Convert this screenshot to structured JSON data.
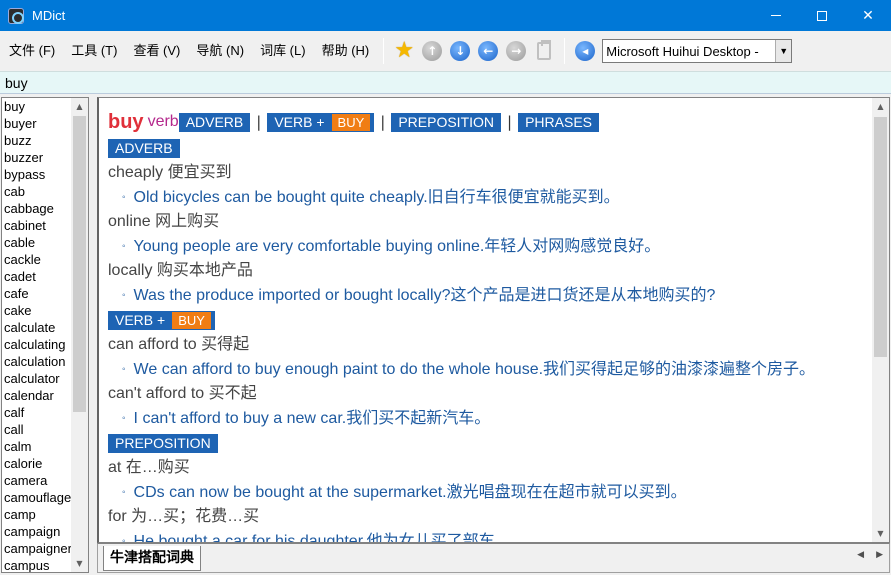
{
  "window": {
    "title": "MDict"
  },
  "menu": [
    "文件 (F)",
    "工具 (T)",
    "查看 (V)",
    "导航 (N)",
    "词库 (L)",
    "帮助 (H)"
  ],
  "toolbar": {
    "font_value": "Microsoft Huihui Desktop -"
  },
  "search": {
    "value": "buy"
  },
  "wordlist": [
    "buy",
    "buyer",
    "buzz",
    "buzzer",
    "bypass",
    "cab",
    "cabbage",
    "cabinet",
    "cable",
    "cackle",
    "cadet",
    "cafe",
    "cake",
    "calculate",
    "calculating",
    "calculation",
    "calculator",
    "calendar",
    "calf",
    "call",
    "calm",
    "calorie",
    "camera",
    "camouflage",
    "camp",
    "campaign",
    "campaigner",
    "campus"
  ],
  "entry": {
    "headword": "buy",
    "pos": "verb",
    "nav": {
      "adverb": "ADVERB",
      "verb": "VERB +",
      "verb_obj": "BUY",
      "preposition": "PREPOSITION",
      "phrases": "PHRASES",
      "sep": "|"
    },
    "sections": [
      {
        "label": "ADVERB",
        "items": [
          {
            "collocation": "cheaply 便宜买到",
            "example": "Old bicycles can be bought quite cheaply.旧自行车很便宜就能买到。"
          },
          {
            "collocation": "online 网上购买",
            "example": "Young people are very comfortable buying online.年轻人对网购感觉良好。"
          },
          {
            "collocation": "locally 购买本地产品",
            "example": "Was the produce imported or bought locally?这个产品是进口货还是从本地购买的?"
          }
        ]
      },
      {
        "label": "VERB +",
        "label_obj": "BUY",
        "items": [
          {
            "collocation": "can afford to 买得起",
            "example": "We can afford to buy enough paint to do the whole house.我们买得起足够的油漆漆遍整个房子。"
          },
          {
            "collocation": "can't afford to 买不起",
            "example": "I can't afford to buy a new car.我们买不起新汽车。"
          }
        ]
      },
      {
        "label": "PREPOSITION",
        "items": [
          {
            "collocation": "at 在…购买",
            "example": "CDs can now be bought at the supermarket.激光唱盘现在在超市就可以买到。"
          },
          {
            "collocation": "for 为…买；花费…买",
            "example": "He bought a car for his daughter.他为女儿买了部车。"
          }
        ]
      }
    ]
  },
  "bullet": "◦",
  "dict_tab": "牛津搭配词典",
  "colors": {
    "titlebar": "#0078d7",
    "headword": "#e0303a",
    "pos": "#b4288c",
    "tag": "#1e64b4",
    "tag_obj": "#f07d14",
    "example": "#1e5aa0",
    "search_bg": "#e6f7f7"
  }
}
